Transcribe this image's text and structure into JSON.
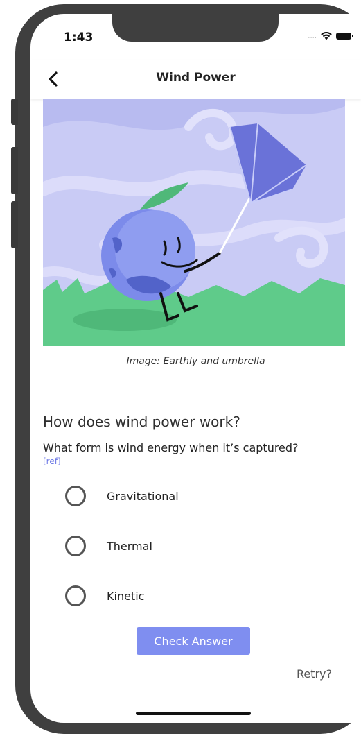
{
  "status_bar": {
    "time": "1:43",
    "dots": "....",
    "icons": [
      "wifi-icon",
      "battery-icon"
    ]
  },
  "header": {
    "title": "Wind Power",
    "back_icon": "chevron-left-icon"
  },
  "illustration": {
    "caption": "Image: Earthly and umbrella"
  },
  "quiz": {
    "heading": "How does wind power work?",
    "prompt": "What form is wind energy when it’s captured?",
    "ref": "[ref]",
    "options": [
      {
        "label": "Gravitational",
        "selected": false
      },
      {
        "label": "Thermal",
        "selected": false
      },
      {
        "label": "Kinetic",
        "selected": false
      }
    ],
    "check_label": "Check Answer",
    "retry_label": "Retry?"
  },
  "colors": {
    "accent": "#7f8ef0",
    "link": "#6d79e6",
    "sky": "#c8caf4",
    "grass": "#5fcb8a"
  }
}
